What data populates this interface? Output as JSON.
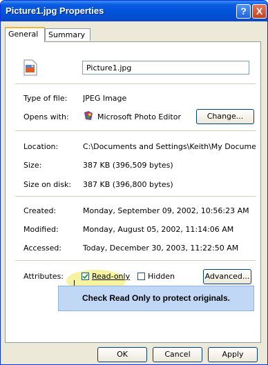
{
  "window": {
    "title": "Picture1.jpg Properties",
    "help_glyph": "?",
    "close_glyph": "X"
  },
  "tabs": [
    {
      "label": "General"
    },
    {
      "label": "Summary"
    }
  ],
  "file": {
    "name": "Picture1.jpg",
    "icon": "jpeg-file-icon"
  },
  "fields": {
    "type_label": "Type of file:",
    "type_value": "JPEG Image",
    "opens_label": "Opens with:",
    "opens_value": "Microsoft Photo Editor",
    "change_button": "Change...",
    "location_label": "Location:",
    "location_value": "C:\\Documents and Settings\\Keith\\My Documents\\M",
    "size_label": "Size:",
    "size_value": "387 KB (396,509 bytes)",
    "size_disk_label": "Size on disk:",
    "size_disk_value": "387 KB (396,800 bytes)",
    "created_label": "Created:",
    "created_value": "Monday, September 09, 2002, 10:56:23 AM",
    "modified_label": "Modified:",
    "modified_value": "Monday, August 05, 2002, 11:14:06 AM",
    "accessed_label": "Accessed:",
    "accessed_value": "Today, December 30, 2003, 11:22:50 AM",
    "attributes_label": "Attributes:",
    "readonly_label": "Read-only",
    "readonly_checked": true,
    "hidden_label": "Hidden",
    "hidden_checked": false,
    "advanced_button": "Advanced..."
  },
  "callout": "Check Read Only to protect originals.",
  "buttons": {
    "ok": "OK",
    "cancel": "Cancel",
    "apply": "Apply"
  },
  "colors": {
    "titlebar": "#0052d9",
    "callout_bg": "#c0d8f6",
    "highlight": "#f6f3a0"
  }
}
